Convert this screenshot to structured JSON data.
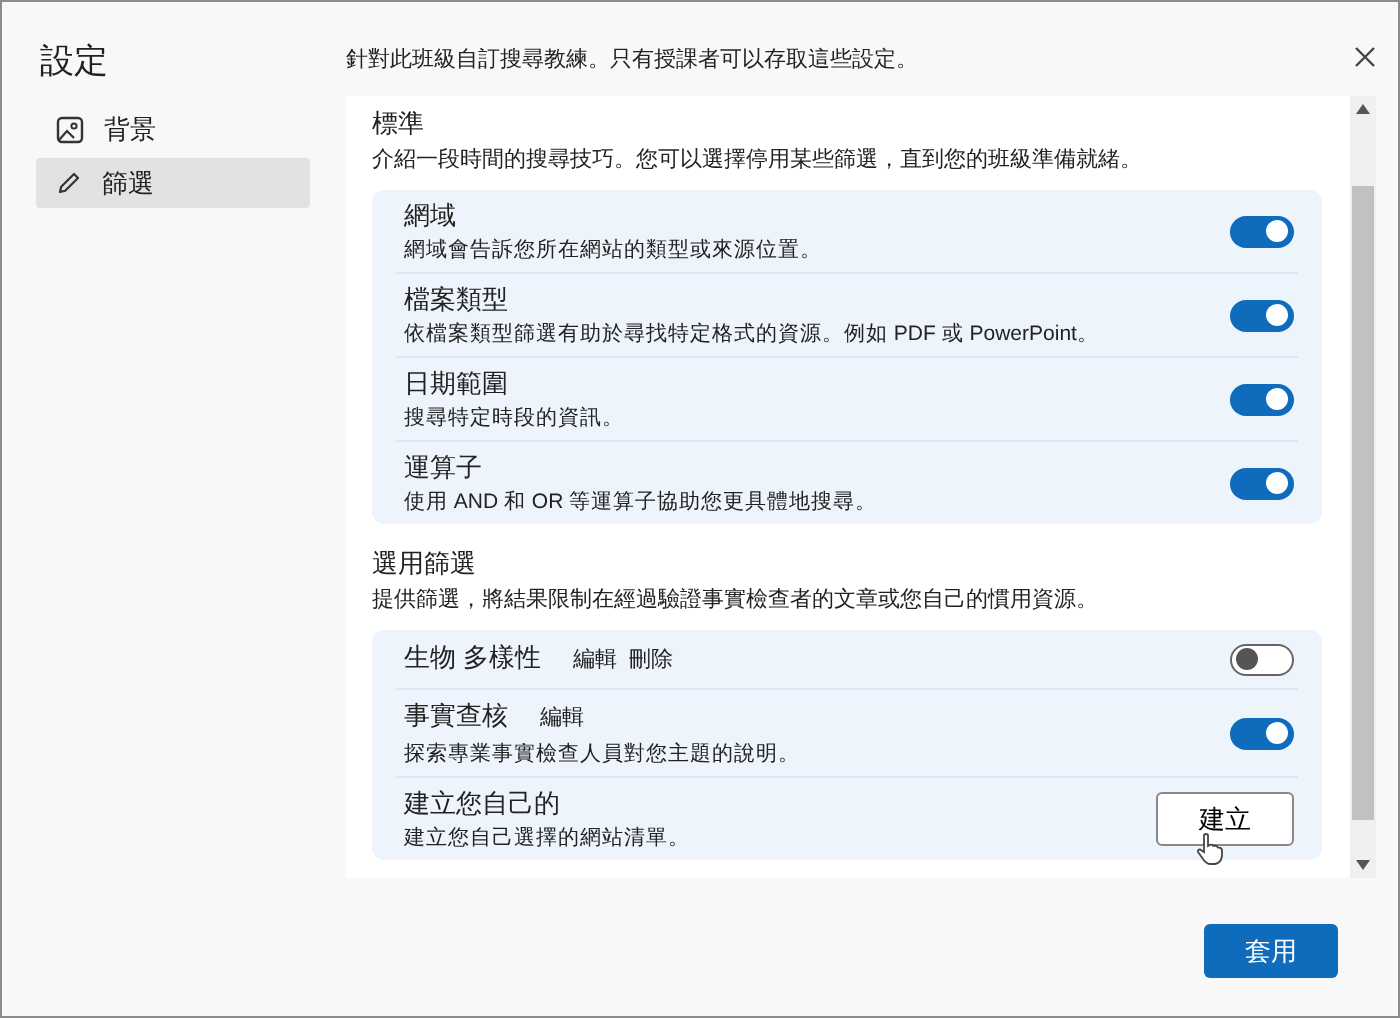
{
  "sidebar": {
    "title": "設定",
    "items": [
      {
        "label": "背景",
        "selected": false
      },
      {
        "label": "篩選",
        "selected": true
      }
    ]
  },
  "header": {
    "subtitle": "針對此班級自訂搜尋教練。只有授課者可以存取這些設定。"
  },
  "sections": [
    {
      "title": "標準",
      "description": "介紹一段時間的搜尋技巧。您可以選擇停用某些篩選，直到您的班級準備就緒。",
      "items": [
        {
          "kind": "toggle",
          "title": "網域",
          "description": "網域會告訴您所在網站的類型或來源位置。",
          "on": true
        },
        {
          "kind": "toggle",
          "title": "檔案類型",
          "description": "依檔案類型篩選有助於尋找特定格式的資源。例如 PDF 或 PowerPoint。",
          "on": true
        },
        {
          "kind": "toggle",
          "title": "日期範圍",
          "description": "搜尋特定時段的資訊。",
          "on": true
        },
        {
          "kind": "toggle",
          "title": "運算子",
          "description": "使用 AND 和 OR 等運算子協助您更具體地搜尋。",
          "on": true
        }
      ]
    },
    {
      "title": "選用篩選",
      "description": "提供篩選，將結果限制在經過驗證事實檢查者的文章或您自己的慣用資源。",
      "items": [
        {
          "kind": "toggle",
          "title": "生物 多樣性",
          "links": [
            "編輯",
            "刪除"
          ],
          "on": false
        },
        {
          "kind": "toggle",
          "title": "事實查核",
          "links": [
            "編輯"
          ],
          "description": "探索專業事實檢查人員對您主題的說明。",
          "on": true
        },
        {
          "kind": "button",
          "title": "建立您自己的",
          "description": "建立您自己選擇的網站清單。",
          "button": "建立"
        }
      ]
    }
  ],
  "footer": {
    "button": "套用"
  }
}
